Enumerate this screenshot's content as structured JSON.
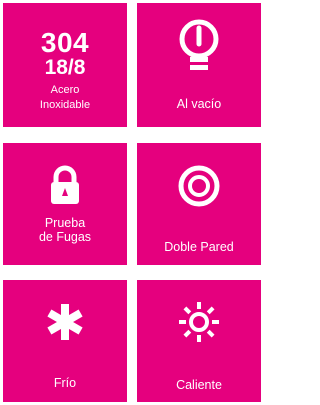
{
  "tiles": [
    {
      "id": "material",
      "icon": "text-badge",
      "big": "304",
      "mid": "18/8",
      "line1": "Acero",
      "line2": "Inoxidable"
    },
    {
      "id": "vacuum",
      "icon": "vacuum-bulb-icon",
      "label": "Al vacío"
    },
    {
      "id": "leakproof",
      "icon": "padlock-icon",
      "line1": "Prueba",
      "line2": "de Fugas"
    },
    {
      "id": "double-wall",
      "icon": "concentric-circles-icon",
      "label": "Doble Pared"
    },
    {
      "id": "cold",
      "icon": "snowflake-asterisk-icon",
      "label": "Frío"
    },
    {
      "id": "hot",
      "icon": "sun-icon",
      "label": "Caliente"
    }
  ],
  "colors": {
    "tile_bg": "#e5007e",
    "tile_border": "#ffffff",
    "text": "#ffffff"
  }
}
